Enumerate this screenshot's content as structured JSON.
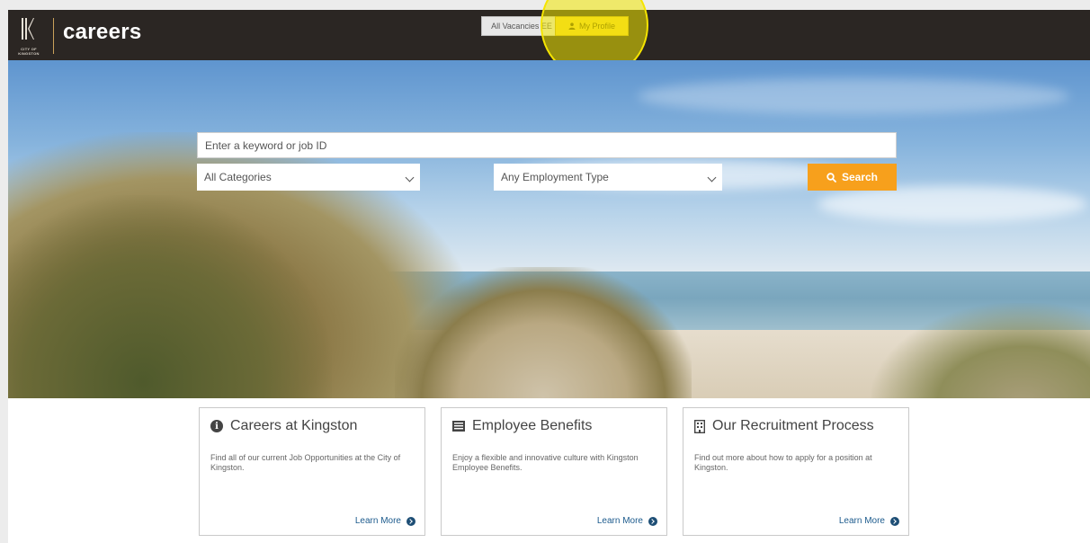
{
  "header": {
    "logo_text": "CITY OF KINGSTON",
    "site_title": "careers",
    "nav": {
      "vacancies_label": "All Vacancies EE",
      "profile_label": "My Profile"
    }
  },
  "search": {
    "keyword_placeholder": "Enter a keyword or job ID",
    "category_selected": "All Categories",
    "employment_selected": "Any Employment Type",
    "button_label": "Search"
  },
  "cards": [
    {
      "title": "Careers at Kingston",
      "description": "Find all of our current Job Opportunities at the City of Kingston.",
      "link_label": "Learn More",
      "icon": "info-circle-icon"
    },
    {
      "title": "Employee Benefits",
      "description": "Enjoy a flexible and innovative culture with Kingston Employee Benefits.",
      "link_label": "Learn More",
      "icon": "benefits-list-icon"
    },
    {
      "title": "Our Recruitment Process",
      "description": "Find out more about how to apply for a position at Kingston.",
      "link_label": "Learn More",
      "icon": "building-icon"
    }
  ],
  "colors": {
    "header_bg": "#2b2623",
    "accent_orange": "#f7a01c",
    "profile_yellow": "#f3d22d",
    "link_blue": "#1d5b8d"
  }
}
